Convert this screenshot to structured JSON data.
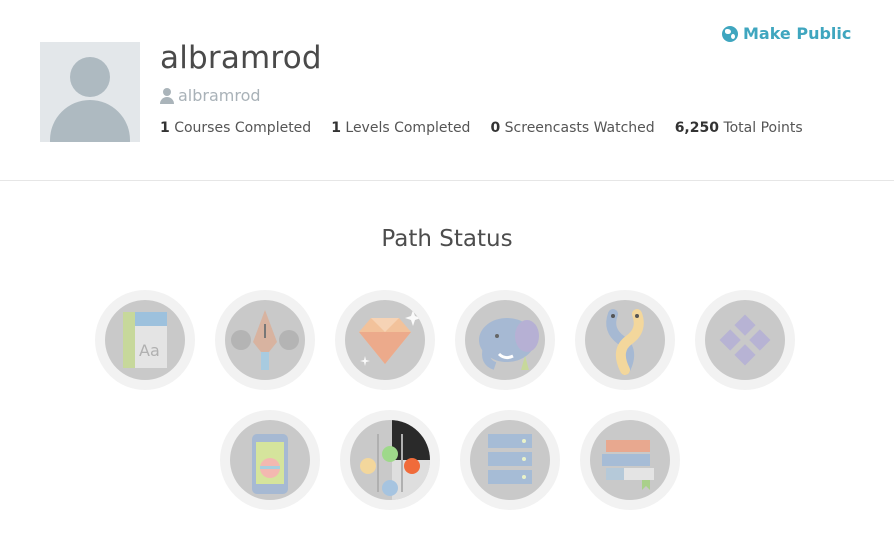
{
  "header": {
    "display_name": "albramrod",
    "username": "albramrod",
    "make_public_label": "Make Public",
    "stats": [
      {
        "count": "1",
        "label": "Courses Completed"
      },
      {
        "count": "1",
        "label": "Levels Completed"
      },
      {
        "count": "0",
        "label": "Screencasts Watched"
      },
      {
        "count": "6,250",
        "label": "Total Points"
      }
    ]
  },
  "main": {
    "section_title": "Path Status"
  },
  "colors": {
    "accent": "#3fa6bf",
    "badge_ring": "#f2f2f2",
    "badge_fill": "#c9c9c9",
    "avatar_bg": "#e3e7ea",
    "avatar_figure": "#aebac1"
  },
  "icons": {
    "user": "user-icon",
    "make_public": "globe-icon",
    "badges": [
      "html-css-path-icon",
      "design-pen-path-icon",
      "ruby-gem-path-icon",
      "php-elephant-path-icon",
      "python-snakes-path-icon",
      "diamond-grid-path-icon",
      "mobile-app-path-icon",
      "javascript-ui-path-icon",
      "server-database-path-icon",
      "books-path-icon"
    ]
  }
}
